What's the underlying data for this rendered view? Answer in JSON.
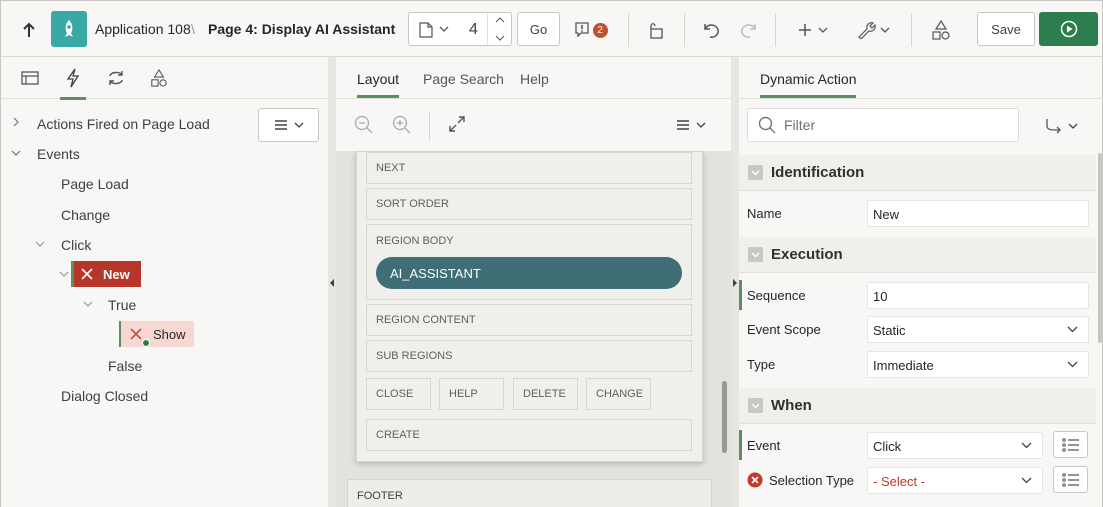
{
  "topbar": {
    "app_name": "Application 108",
    "page_title": "Page 4: Display AI Assistant",
    "page_number": "4",
    "go_label": "Go",
    "issues_count": "2",
    "save_label": "Save"
  },
  "tree": {
    "actions_fired": "Actions Fired on Page Load",
    "events": "Events",
    "page_load": "Page Load",
    "change": "Change",
    "click": "Click",
    "new_label": "New",
    "true_label": "True",
    "show_label": "Show",
    "false_label": "False",
    "dialog_closed": "Dialog Closed"
  },
  "layout": {
    "tabs": [
      "Layout",
      "Page Search",
      "Help"
    ],
    "slots": {
      "next": "NEXT",
      "sort_order": "SORT ORDER",
      "region_body": "REGION BODY",
      "region_content": "REGION CONTENT",
      "sub_regions": "SUB REGIONS",
      "close": "CLOSE",
      "help": "HELP",
      "delete": "DELETE",
      "change": "CHANGE",
      "create": "CREATE",
      "footer": "FOOTER"
    },
    "region_pill": "AI_ASSISTANT"
  },
  "props": {
    "tab": "Dynamic Action",
    "filter_placeholder": "Filter",
    "identification": "Identification",
    "name_label": "Name",
    "name_value": "New",
    "execution": "Execution",
    "sequence_label": "Sequence",
    "sequence_value": "10",
    "event_scope_label": "Event Scope",
    "event_scope_value": "Static",
    "type_label": "Type",
    "type_value": "Immediate",
    "when": "When",
    "event_label": "Event",
    "event_value": "Click",
    "selection_type_label": "Selection Type",
    "selection_type_value": "- Select -"
  },
  "colors": {
    "accent_green": "#5c8f5c",
    "run_button": "#2e7d4f",
    "error_red": "#c0392b",
    "region_pill": "#3f6e77",
    "app_icon": "#3aa9a6"
  }
}
